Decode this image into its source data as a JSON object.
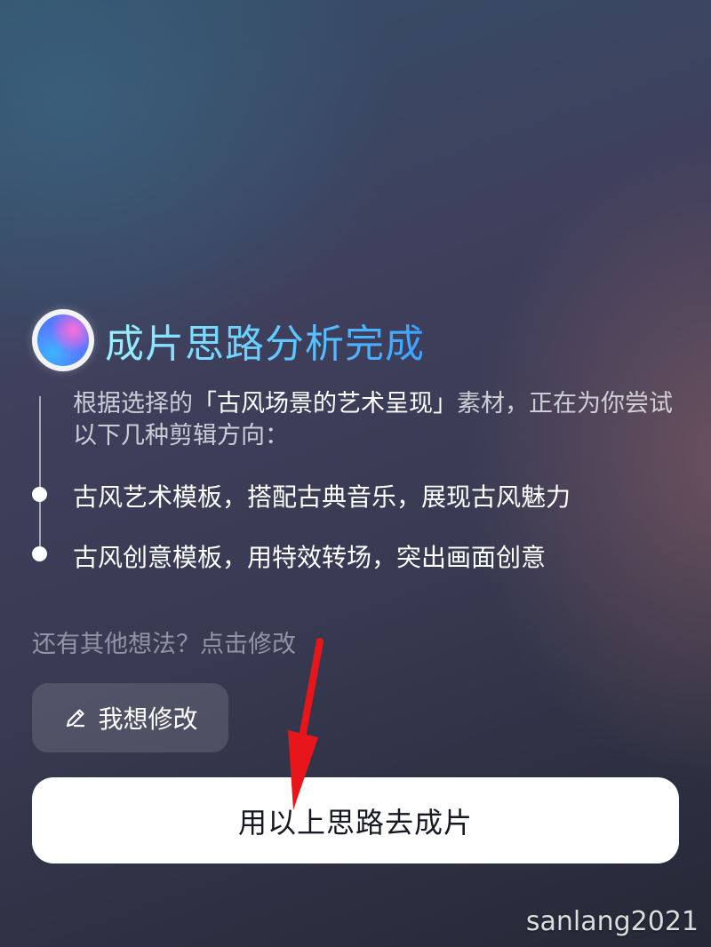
{
  "header": {
    "title": "成片思路分析完成",
    "orb_icon": "gradient-orb-icon"
  },
  "analysis": {
    "intro_prefix": "根据选择的",
    "material_name": "「古风场景的艺术呈现」",
    "intro_suffix": "素材，正在为你尝试以下几种剪辑方向：",
    "options": [
      {
        "label": "古风艺术模板，搭配古典音乐，展现古风魅力"
      },
      {
        "label": "古风创意模板，用特效转场，突出画面创意"
      }
    ]
  },
  "hint": {
    "text": "还有其他想法？点击修改"
  },
  "modify_button": {
    "label": "我想修改",
    "icon": "pencil-icon"
  },
  "primary_button": {
    "label": "用以上思路去成片"
  },
  "annotation": {
    "icon": "red-arrow-icon",
    "color": "#e8161b"
  },
  "watermark": {
    "text": "sanlang2021"
  },
  "colors": {
    "title_gradient_start": "#9cf1ff",
    "title_gradient_end": "#3aa2ff",
    "primary_button_bg": "#ffffff",
    "primary_button_text": "#161823"
  }
}
